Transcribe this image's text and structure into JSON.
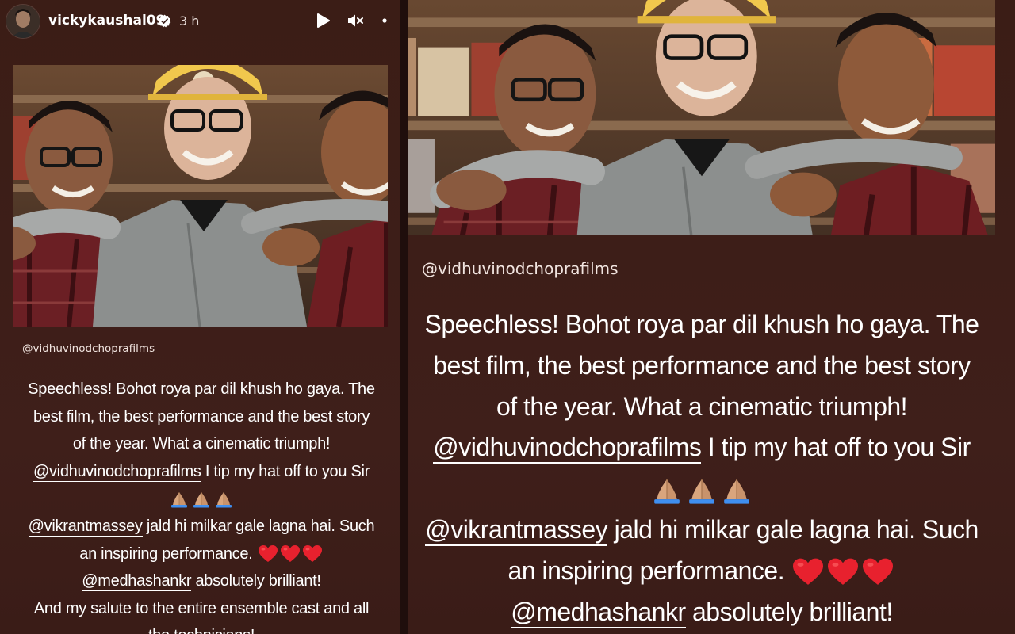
{
  "header": {
    "username": "vickykaushal09",
    "timestamp": "3 h",
    "icons": [
      "play-icon",
      "mute-icon",
      "more-icon",
      "verified-icon"
    ]
  },
  "left_panel": {
    "credit": "@vidhuvinodchoprafilms",
    "caption": {
      "line1": "Speechless! Bohot roya par dil khush ho gaya. The",
      "line2": "best film, the best performance and the best story",
      "line3": "of the year. What a cinematic triumph!",
      "mention1": "@vidhuvinodchoprafilms",
      "line4_rest": " I tip my hat off to you Sir",
      "mention2": "@vikrantmassey",
      "line6_rest": " jald hi milkar gale lagna hai. Such",
      "line7": "an inspiring performance. ",
      "mention3": "@medhashankr",
      "line8_rest": " absolutely brilliant!",
      "line9": "And my salute to the entire ensemble cast and all",
      "line10": "the technicians!"
    }
  },
  "right_panel": {
    "credit": "@vidhuvinodchoprafilms",
    "caption": {
      "line1": "Speechless! Bohot roya par dil khush ho gaya. The",
      "line2": "best film, the best performance and the best story",
      "line3": "of the year. What a cinematic triumph!",
      "mention1": "@vidhuvinodchoprafilms",
      "line4_rest": " I tip my hat off to you Sir",
      "mention2": "@vikrantmassey",
      "line6_rest": " jald hi milkar gale lagna hai. Such",
      "line7": "an inspiring performance. ",
      "mention3": "@medhashankr",
      "line8_rest": " absolutely brilliant!"
    }
  },
  "colors": {
    "background": "#3d1e18",
    "text": "#ffffff",
    "heart": "#e8212e",
    "hands_skin": "#d9a57d",
    "hands_cuff": "#3f8ff0"
  }
}
